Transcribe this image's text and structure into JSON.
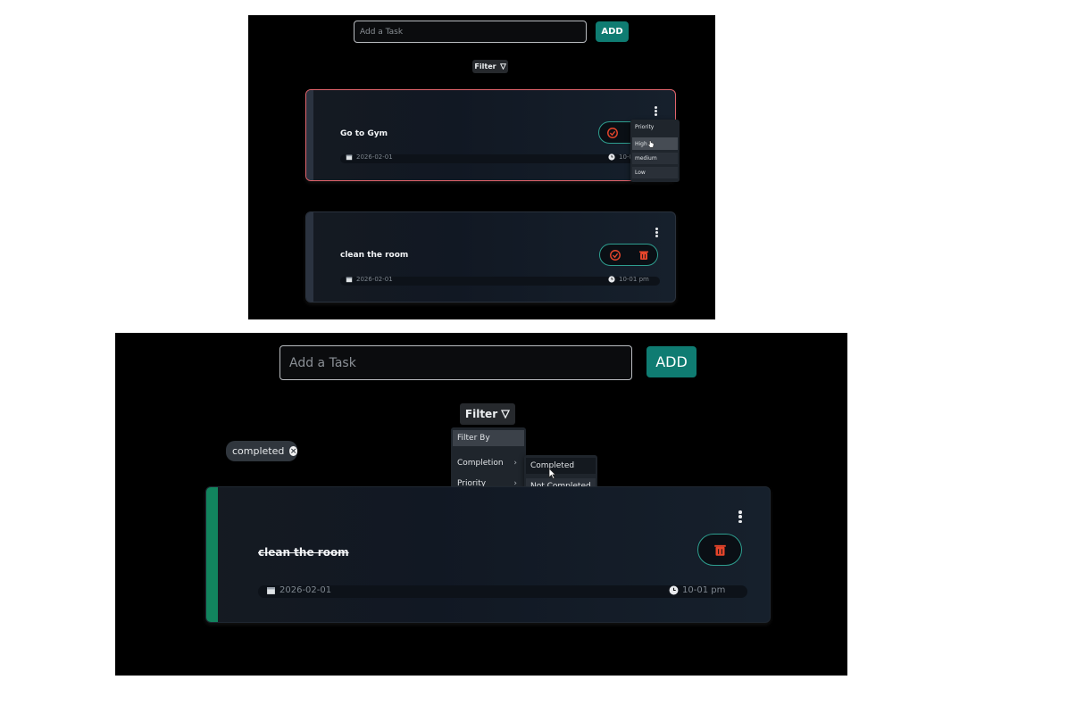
{
  "top": {
    "input_placeholder": "Add a Task",
    "add_label": "ADD",
    "filter_label": "Filter",
    "filter_icon": "filter-icon",
    "tasks": [
      {
        "title": "Go to Gym",
        "date": "2026-02-01",
        "time": "10-0"
      },
      {
        "title": "clean the room",
        "date": "2026-02-01",
        "time": "10-01 pm"
      }
    ],
    "priority_menu": {
      "header": "Priority",
      "items": [
        "High",
        "medium",
        "Low"
      ],
      "hovered": "High"
    }
  },
  "bottom": {
    "input_placeholder": "Add a Task",
    "add_label": "ADD",
    "filter_label": "Filter",
    "filter_chip": "completed",
    "filter_menu": {
      "header": "Filter By",
      "completion": "Completion",
      "priority": "Priority",
      "sub_completed": "Completed",
      "sub_not_completed": "Not Completed"
    },
    "task": {
      "title": "clean the room",
      "date": "2026-02-01",
      "time": "10-01 pm"
    }
  },
  "colors": {
    "accent_teal": "#0f7c72",
    "high_priority_border": "#e2646c",
    "completed_stripe": "#12845e",
    "delete_red": "#e5452b"
  }
}
